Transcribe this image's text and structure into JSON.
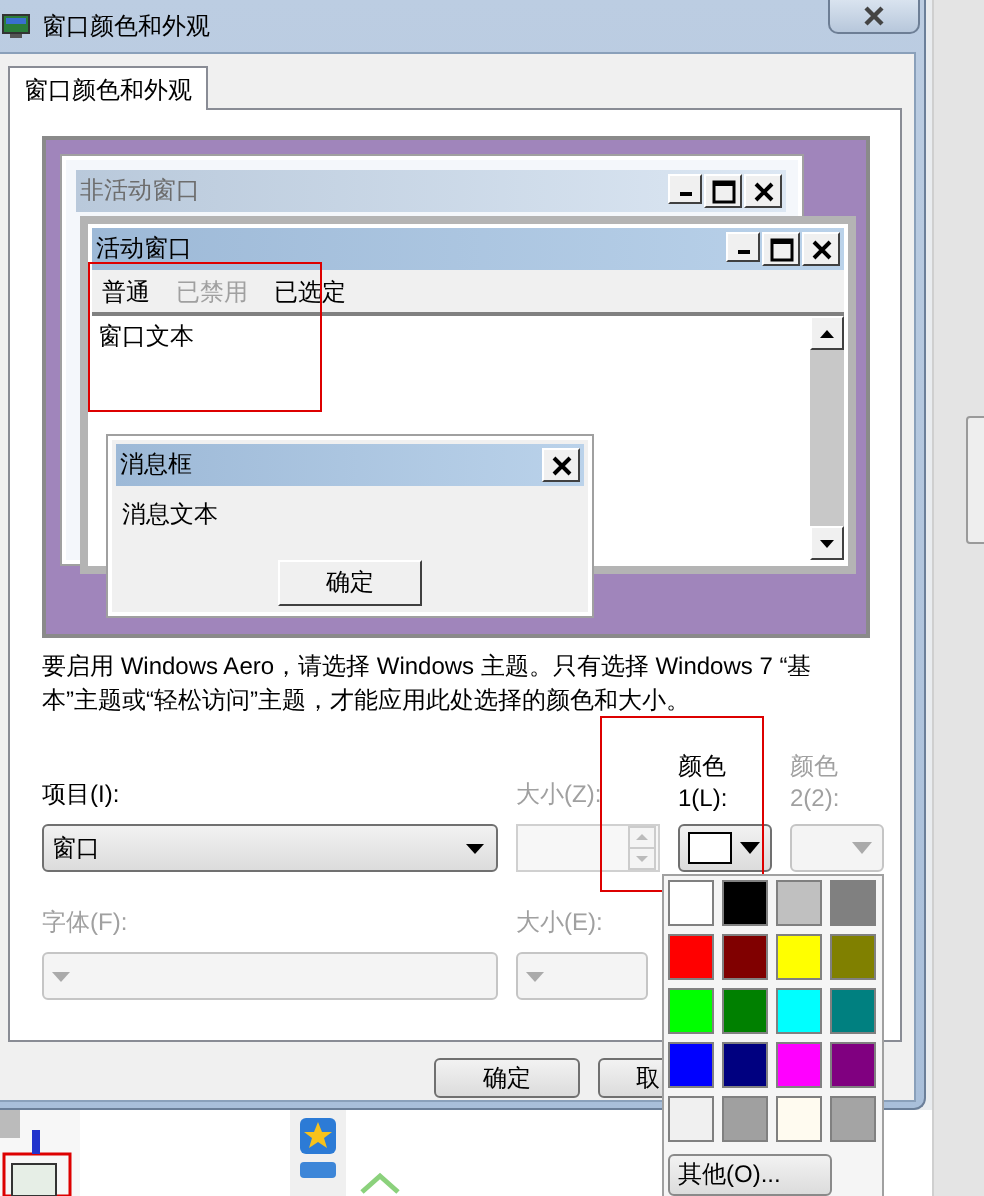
{
  "window": {
    "title": "窗口颜色和外观"
  },
  "tabs": [
    {
      "label": "窗口颜色和外观",
      "selected": true
    }
  ],
  "preview": {
    "inactive_window": {
      "title": "非活动窗口"
    },
    "active_window": {
      "title": "活动窗口",
      "menu": [
        {
          "label": "普通",
          "disabled": false
        },
        {
          "label": "已禁用",
          "disabled": true
        },
        {
          "label": "已选定",
          "disabled": false
        }
      ],
      "text": "窗口文本"
    },
    "message_box": {
      "title": "消息框",
      "text": "消息文本",
      "button": "确定"
    }
  },
  "description": "要启用 Windows Aero，请选择 Windows 主题。只有选择 Windows 7 “基本”主题或“轻松访问”主题，才能应用此处选择的颜色和大小。",
  "item": {
    "label": "项目(I):",
    "value": "窗口",
    "disabled": false
  },
  "size": {
    "label": "大小(Z):",
    "disabled": true
  },
  "color1": {
    "label": "颜色 1(L):",
    "color": "#ffffff",
    "disabled": false
  },
  "color2": {
    "label": "颜色 2(2):",
    "disabled": true
  },
  "font": {
    "label": "字体(F):",
    "disabled": true
  },
  "font_size": {
    "label": "大小(E):",
    "disabled": true
  },
  "buttons": [
    {
      "label": "确定"
    },
    {
      "label": "取"
    }
  ],
  "palette": {
    "swatches": [
      {
        "color": "#ffffff"
      },
      {
        "color": "#000000"
      },
      {
        "color": "#c0c0c0"
      },
      {
        "color": "#808080"
      },
      {
        "color": "#ff0000"
      },
      {
        "color": "#800000"
      },
      {
        "color": "#ffff00"
      },
      {
        "color": "#808000"
      },
      {
        "color": "#00ff00"
      },
      {
        "color": "#008000"
      },
      {
        "color": "#00ffff"
      },
      {
        "color": "#008080"
      },
      {
        "color": "#0000ff"
      },
      {
        "color": "#000080"
      },
      {
        "color": "#ff00ff"
      },
      {
        "color": "#800080"
      },
      {
        "color": "#f0f0f0"
      },
      {
        "color": "#a0a0a0"
      },
      {
        "color": "#fffbf0"
      },
      {
        "color": "#a4a4a4"
      }
    ],
    "other_button": "其他(O)..."
  }
}
